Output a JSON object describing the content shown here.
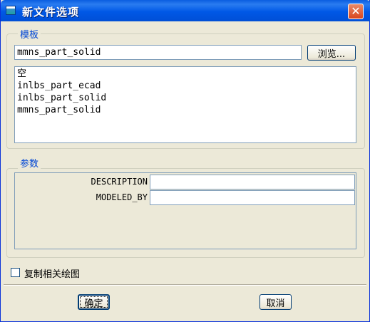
{
  "window": {
    "title": "新文件选项",
    "close_icon": "close-icon"
  },
  "template_group": {
    "legend": "模板",
    "template_input_value": "mmns_part_solid",
    "browse_label": "浏览...",
    "list_items": [
      "空",
      "inlbs_part_ecad",
      "inlbs_part_solid",
      "mmns_part_solid"
    ]
  },
  "params_group": {
    "legend": "参数",
    "rows": [
      {
        "label": "DESCRIPTION",
        "value": ""
      },
      {
        "label": "MODELED_BY",
        "value": ""
      }
    ]
  },
  "copy_drawings": {
    "label": "复制相关绘图",
    "checked": false
  },
  "buttons": {
    "ok": "确定",
    "cancel": "取消"
  },
  "colors": {
    "title_bar": "#0058e6",
    "close_button": "#d8451d",
    "legend_text": "#0046d5",
    "dialog_bg": "#ece9d8"
  }
}
